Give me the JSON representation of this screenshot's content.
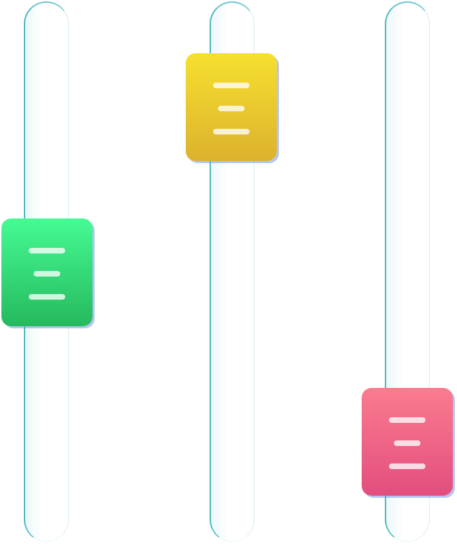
{
  "sliders": [
    {
      "name": "green",
      "value_fraction": 0.5,
      "color_top": "#45fb94",
      "color_bottom": "#26b95d",
      "grip_icon": "grip-lines-icon"
    },
    {
      "name": "yellow",
      "value_fraction": 0.88,
      "color_top": "#f6e02e",
      "color_bottom": "#dcb22e",
      "grip_icon": "grip-lines-icon"
    },
    {
      "name": "pink",
      "value_fraction": 0.12,
      "color_top": "#fb7c8f",
      "color_bottom": "#e24e7e",
      "grip_icon": "grip-lines-icon"
    }
  ],
  "colors": {
    "track_border": "#4fb9c4",
    "thumb_shadow": "#7896e6",
    "background": "#ffffff"
  }
}
